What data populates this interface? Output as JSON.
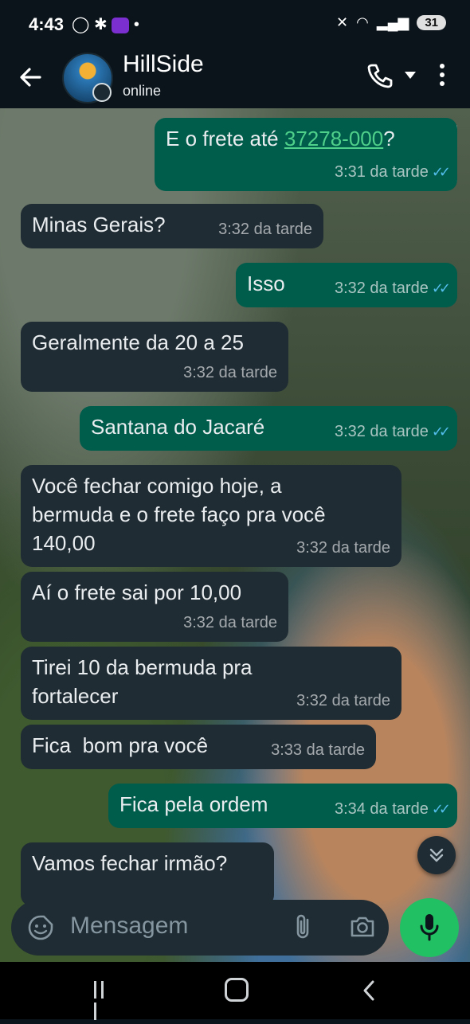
{
  "status_bar": {
    "time": "4:43",
    "notification_icons": "whatsapp-icon, accessibility-icon, olx-icon, dot",
    "battery": "31"
  },
  "header": {
    "contact_name": "HillSide",
    "status": "online"
  },
  "messages": [
    {
      "dir": "out",
      "text_prefix": "E o frete até ",
      "link": "37278-000",
      "text_suffix": "?",
      "time": "3:31 da tarde",
      "ticks": "✓✓"
    },
    {
      "dir": "in",
      "text": "Minas Gerais?",
      "time": "3:32 da tarde"
    },
    {
      "dir": "out",
      "text": "Isso",
      "time": "3:32 da tarde",
      "ticks": "✓✓"
    },
    {
      "dir": "in",
      "text": "Geralmente da 20 a 25",
      "time": "3:32 da tarde"
    },
    {
      "dir": "out",
      "text": "Santana do Jacaré",
      "time": "3:32 da tarde",
      "ticks": "✓✓"
    },
    {
      "dir": "in",
      "line1": "Você fechar comigo hoje, a",
      "line2": "bermuda e o frete faço pra você",
      "line3": "140,00",
      "time": "3:32 da tarde"
    },
    {
      "dir": "in",
      "text": "Aí o frete sai por 10,00",
      "time": "3:32 da tarde"
    },
    {
      "dir": "in",
      "line1": "Tirei 10 da bermuda pra",
      "line2": "fortalecer",
      "time": "3:32 da tarde"
    },
    {
      "dir": "in",
      "text": "Fica  bom pra você",
      "time": "3:33 da tarde"
    },
    {
      "dir": "out",
      "text": "Fica pela ordem",
      "time": "3:34 da tarde",
      "ticks": "✓✓"
    },
    {
      "dir": "in",
      "text": "Vamos fechar irmão?"
    }
  ],
  "input": {
    "placeholder": "Mensagem"
  },
  "colors": {
    "incoming_bubble": "#202c33",
    "outgoing_bubble": "#005c4b",
    "read_ticks": "#53bdeb",
    "mic_button": "#21c063",
    "link": "#4fd08a"
  }
}
